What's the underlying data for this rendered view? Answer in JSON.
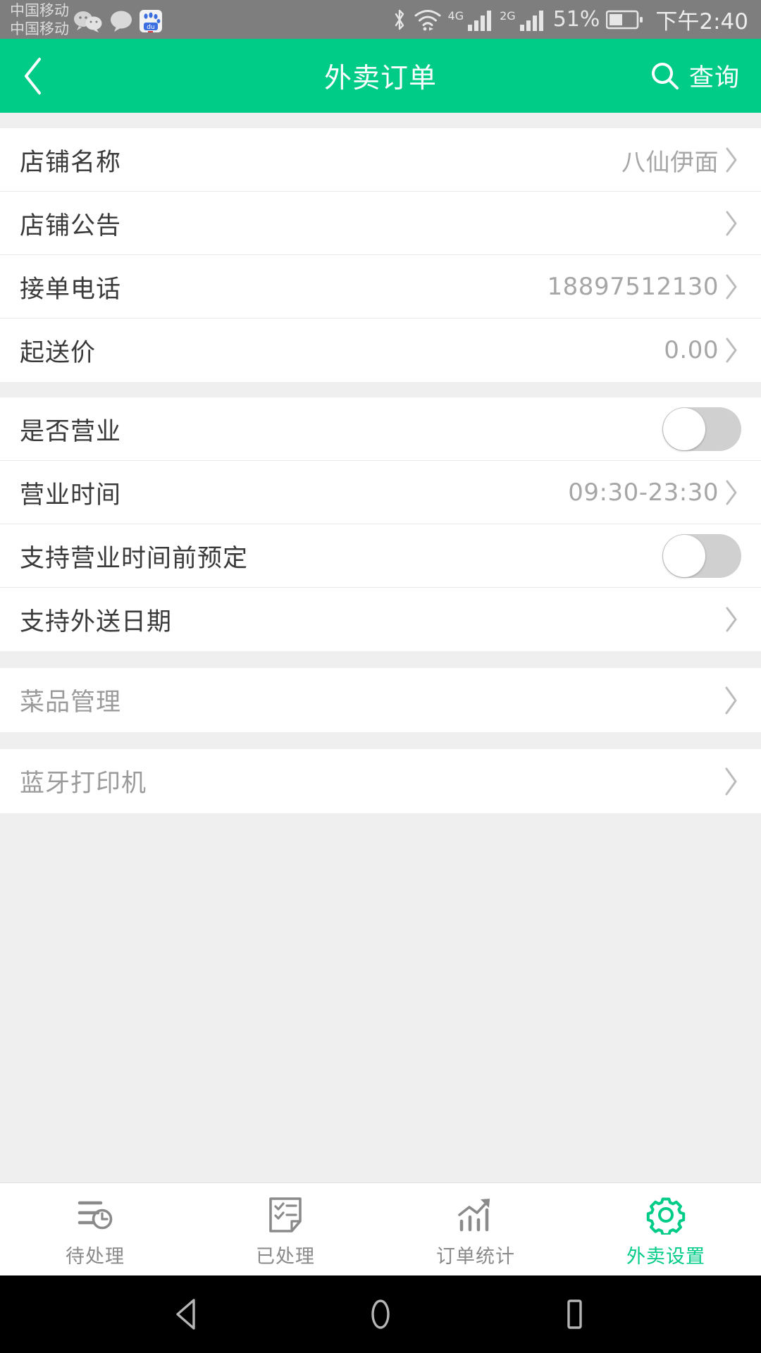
{
  "status_bar": {
    "carrier_line1": "中国移动",
    "carrier_line2": "中国移动",
    "app_icons": [
      "wechat-icon",
      "message-icon",
      "baidu-icon"
    ],
    "bluetooth": "bluetooth-icon",
    "wifi": "wifi-icon",
    "signal1_label": "4G",
    "signal2_label": "2G",
    "battery_percent": "51%",
    "battery": "battery-icon",
    "time": "下午2:40"
  },
  "header": {
    "back_icon": "chevron-left-icon",
    "title": "外卖订单",
    "search_icon": "search-icon",
    "search_label": "查询"
  },
  "sections": [
    {
      "rows": [
        {
          "label": "店铺名称",
          "value": "八仙伊面",
          "type": "link",
          "muted": false
        },
        {
          "label": "店铺公告",
          "value": "",
          "type": "link",
          "muted": false
        },
        {
          "label": "接单电话",
          "value": "18897512130",
          "type": "link",
          "muted": false
        },
        {
          "label": "起送价",
          "value": "0.00",
          "type": "link",
          "muted": false
        }
      ]
    },
    {
      "rows": [
        {
          "label": "是否营业",
          "value": "",
          "type": "switch",
          "switch_on": false,
          "muted": false
        },
        {
          "label": "营业时间",
          "value": "09:30-23:30",
          "type": "link",
          "muted": false
        },
        {
          "label": "支持营业时间前预定",
          "value": "",
          "type": "switch",
          "switch_on": false,
          "muted": false
        },
        {
          "label": "支持外送日期",
          "value": "",
          "type": "link",
          "muted": false
        }
      ]
    },
    {
      "rows": [
        {
          "label": "菜品管理",
          "value": "",
          "type": "link",
          "muted": true
        }
      ]
    },
    {
      "rows": [
        {
          "label": "蓝牙打印机",
          "value": "",
          "type": "link",
          "muted": true
        }
      ]
    }
  ],
  "tabbar": {
    "tabs": [
      {
        "label": "待处理",
        "icon": "pending-list-clock-icon",
        "active": false
      },
      {
        "label": "已处理",
        "icon": "checklist-document-icon",
        "active": false
      },
      {
        "label": "订单统计",
        "icon": "bar-chart-arrow-icon",
        "active": false
      },
      {
        "label": "外卖设置",
        "icon": "gear-icon",
        "active": true
      }
    ]
  },
  "navbar": {
    "back": "android-back-icon",
    "home": "android-home-icon",
    "recents": "android-recents-icon"
  },
  "colors": {
    "accent": "#00cc88",
    "status_bar": "#7e7e7e",
    "page_bg": "#efefef",
    "label": "#3a3a3a",
    "value": "#a6a6a6",
    "muted_label": "#9b9b9b"
  }
}
